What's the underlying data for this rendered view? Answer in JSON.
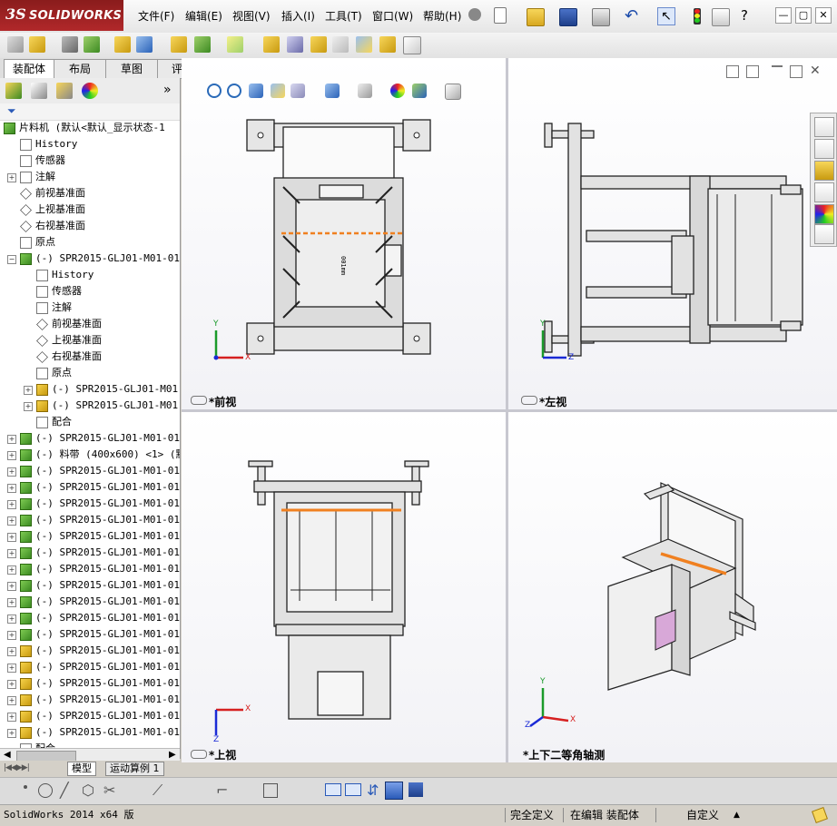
{
  "app": {
    "logo_ds": "3S",
    "logo_name": "SOLIDWORKS"
  },
  "menu": [
    "文件(F)",
    "编辑(E)",
    "视图(V)",
    "插入(I)",
    "工具(T)",
    "窗口(W)",
    "帮助(H)"
  ],
  "window_controls": {
    "minimize": "—",
    "restore": "▢",
    "close": "✕"
  },
  "tabs": [
    "装配体",
    "布局",
    "草图",
    "评估"
  ],
  "active_tab": "装配体",
  "tree": {
    "root_label": "片料机  (默认<默认_显示状态-1",
    "items": [
      {
        "label": "History",
        "icon": "history-icon",
        "indent": 1
      },
      {
        "label": "传感器",
        "icon": "sensor-icon",
        "indent": 1
      },
      {
        "label": "注解",
        "icon": "annotation-icon",
        "indent": 1,
        "expandable": true
      },
      {
        "label": "前视基准面",
        "icon": "plane-icon",
        "indent": 1
      },
      {
        "label": "上视基准面",
        "icon": "plane-icon",
        "indent": 1
      },
      {
        "label": "右视基准面",
        "icon": "plane-icon",
        "indent": 1
      },
      {
        "label": "原点",
        "icon": "origin-icon",
        "indent": 1
      },
      {
        "label": "(-) SPR2015-GLJ01-M01-01-A",
        "icon": "assembly-icon",
        "indent": 1,
        "expandable": true,
        "expanded": true
      },
      {
        "label": "History",
        "icon": "history-icon",
        "indent": 2
      },
      {
        "label": "传感器",
        "icon": "sensor-icon",
        "indent": 2
      },
      {
        "label": "注解",
        "icon": "annotation-icon",
        "indent": 2
      },
      {
        "label": "前视基准面",
        "icon": "plane-icon",
        "indent": 2
      },
      {
        "label": "上视基准面",
        "icon": "plane-icon",
        "indent": 2
      },
      {
        "label": "右视基准面",
        "icon": "plane-icon",
        "indent": 2
      },
      {
        "label": "原点",
        "icon": "origin-icon",
        "indent": 2
      },
      {
        "label": "(-) SPR2015-GLJ01-M01-",
        "icon": "part-icon",
        "indent": 2,
        "expandable": true
      },
      {
        "label": "(-) SPR2015-GLJ01-M01-",
        "icon": "part-icon",
        "indent": 2,
        "expandable": true
      },
      {
        "label": "配合",
        "icon": "mate-icon",
        "indent": 2
      },
      {
        "label": "(-) SPR2015-GLJ01-M01-01-A",
        "icon": "assembly-icon",
        "indent": 1,
        "expandable": true
      },
      {
        "label": "(-) 料带 (400x600) <1> (默",
        "icon": "assembly-icon",
        "indent": 1,
        "expandable": true
      },
      {
        "label": "(-) SPR2015-GLJ01-M01-01-A",
        "icon": "assembly-icon",
        "indent": 1,
        "expandable": true
      },
      {
        "label": "(-) SPR2015-GLJ01-M01-01-A",
        "icon": "assembly-icon",
        "indent": 1,
        "expandable": true
      },
      {
        "label": "(-) SPR2015-GLJ01-M01-01-A",
        "icon": "assembly-icon",
        "indent": 1,
        "expandable": true
      },
      {
        "label": "(-) SPR2015-GLJ01-M01-01-A",
        "icon": "assembly-icon",
        "indent": 1,
        "expandable": true
      },
      {
        "label": "(-) SPR2015-GLJ01-M01-01-A",
        "icon": "assembly-icon",
        "indent": 1,
        "expandable": true
      },
      {
        "label": "(-) SPR2015-GLJ01-M01-01-A",
        "icon": "assembly-icon",
        "indent": 1,
        "expandable": true
      },
      {
        "label": "(-) SPR2015-GLJ01-M01-01-A",
        "icon": "assembly-icon",
        "indent": 1,
        "expandable": true
      },
      {
        "label": "(-) SPR2015-GLJ01-M01-01-A",
        "icon": "assembly-icon",
        "indent": 1,
        "expandable": true
      },
      {
        "label": "(-) SPR2015-GLJ01-M01-01-A",
        "icon": "assembly-icon",
        "indent": 1,
        "expandable": true
      },
      {
        "label": "(-) SPR2015-GLJ01-M01-01-A",
        "icon": "assembly-icon",
        "indent": 1,
        "expandable": true
      },
      {
        "label": "(-) SPR2015-GLJ01-M01-01-A",
        "icon": "assembly-icon",
        "indent": 1,
        "expandable": true
      },
      {
        "label": "(-) SPR2015-GLJ01-M01-01-B",
        "icon": "part-icon",
        "indent": 1,
        "expandable": true
      },
      {
        "label": "(-) SPR2015-GLJ01-M01-01-B",
        "icon": "part-icon",
        "indent": 1,
        "expandable": true
      },
      {
        "label": "(-) SPR2015-GLJ01-M01-01-B",
        "icon": "part-icon",
        "indent": 1,
        "expandable": true
      },
      {
        "label": "(-) SPR2015-GLJ01-M01-01-B",
        "icon": "part-icon",
        "indent": 1,
        "expandable": true
      },
      {
        "label": "(-) SPR2015-GLJ01-M01-01-B",
        "icon": "part-icon",
        "indent": 1,
        "expandable": true
      },
      {
        "label": "(-) SPR2015-GLJ01-M01-01-B",
        "icon": "part-icon",
        "indent": 1,
        "expandable": true
      },
      {
        "label": "配合",
        "icon": "mate-icon",
        "indent": 1
      }
    ]
  },
  "bottom_tabs": [
    "模型",
    "运动算例 1"
  ],
  "active_bottom_tab": "模型",
  "viewports": {
    "front": "*前视",
    "left": "*左视",
    "top": "*上视",
    "iso": "*上下二等角轴测"
  },
  "axis_labels": {
    "x": "X",
    "y": "Y",
    "z": "Z"
  },
  "part_label": "001mm",
  "status": {
    "version": "SolidWorks 2014 x64 版",
    "definition": "完全定义",
    "editing": "在编辑 装配体",
    "units": "自定义",
    "units_arrow": "▲"
  },
  "colors": {
    "brand_red": "#b1282a",
    "highlight_orange": "#f08020",
    "axis_x": "#d62020",
    "axis_y": "#1a9a2a",
    "axis_z": "#1a2ad6"
  }
}
